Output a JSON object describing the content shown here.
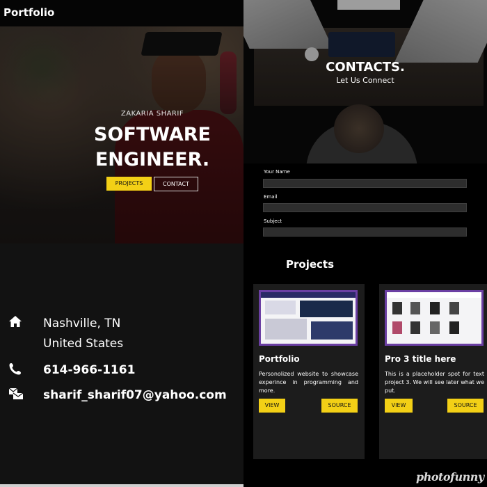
{
  "nav": {
    "brand": "Portfolio"
  },
  "hero": {
    "name": "ZAKARIA SHARIF",
    "title_line1": "SOFTWARE",
    "title_line2": "ENGINEER.",
    "projects_button": "PROJECTS",
    "contact_button": "CONTACT"
  },
  "info": {
    "city": "Nashville, TN",
    "country": "United States",
    "phone": "614-966-1161",
    "email": "sharif_sharif07@yahoo.com",
    "icons": [
      "home-icon",
      "phone-icon",
      "mail-icon"
    ]
  },
  "contacts": {
    "title": "CONTACTS.",
    "subtitle": "Let Us Connect",
    "fields": [
      "Your Name",
      "Email",
      "Subject"
    ]
  },
  "projects": {
    "title": "Projects",
    "cards": [
      {
        "title": "Portfolio",
        "description": "Personolized website to showcase experince in programming and more.",
        "view": "VIEW",
        "source": "SOURCE"
      },
      {
        "title": "Pro 3 title here",
        "description": "This is a placeholder spot for text project 3. We will see later what we put.",
        "view": "VIEW",
        "source": "SOURCE"
      }
    ]
  },
  "colors": {
    "accent": "#f3d016",
    "card_bg": "#1c1c1c",
    "panel_bg": "#121212"
  },
  "watermark": "photofunny"
}
